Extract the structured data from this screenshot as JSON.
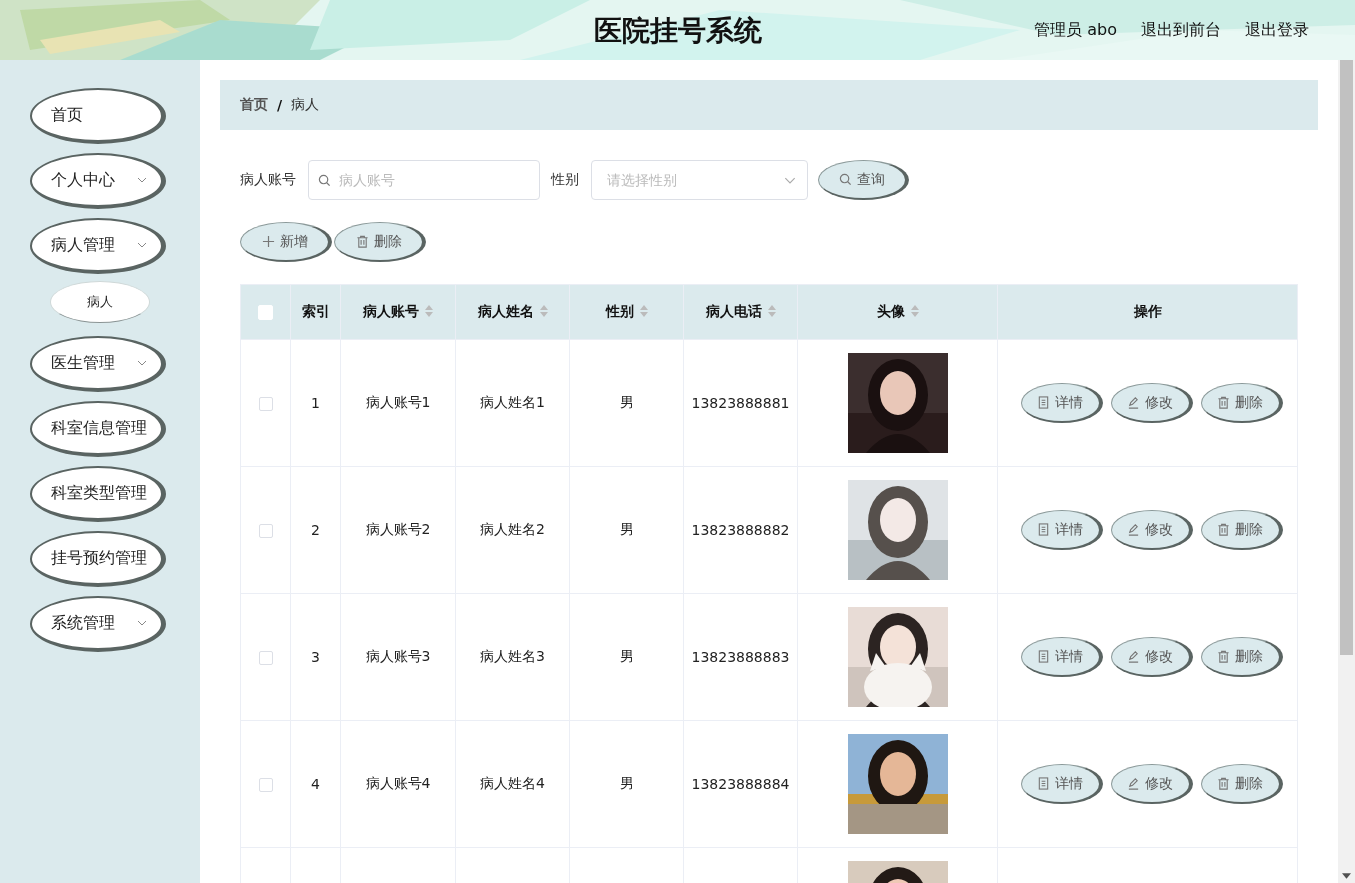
{
  "header": {
    "title": "医院挂号系统",
    "links": [
      "管理员 abo",
      "退出到前台",
      "退出登录"
    ]
  },
  "sidebar": {
    "items": [
      {
        "kind": "link",
        "label": "首页"
      },
      {
        "kind": "group",
        "label": "个人中心"
      },
      {
        "kind": "group",
        "label": "病人管理",
        "children": [
          {
            "label": "病人"
          }
        ]
      },
      {
        "kind": "group",
        "label": "医生管理"
      },
      {
        "kind": "link",
        "label": "科室信息管理"
      },
      {
        "kind": "link",
        "label": "科室类型管理"
      },
      {
        "kind": "link",
        "label": "挂号预约管理"
      },
      {
        "kind": "group",
        "label": "系统管理"
      }
    ]
  },
  "breadcrumb": {
    "items": [
      "首页",
      "病人"
    ],
    "separator": "/"
  },
  "search": {
    "fields": [
      {
        "kind": "text",
        "label": "病人账号",
        "placeholder": "病人账号"
      },
      {
        "kind": "select",
        "label": "性别",
        "placeholder": "请选择性别"
      }
    ],
    "button": "查询"
  },
  "actions": [
    {
      "kind": "add",
      "label": "新增"
    },
    {
      "kind": "delete",
      "label": "删除"
    }
  ],
  "table": {
    "header_checkbox": {
      "checked": false
    },
    "columns": [
      {
        "label": "索引",
        "sortable": false
      },
      {
        "label": "病人账号",
        "sortable": true
      },
      {
        "label": "病人姓名",
        "sortable": true
      },
      {
        "label": "性别",
        "sortable": true
      },
      {
        "label": "病人电话",
        "sortable": true
      },
      {
        "label": "头像",
        "sortable": true
      },
      {
        "label": "操作",
        "sortable": false
      }
    ],
    "rows": [
      {
        "checked": false,
        "cells": [
          "1",
          "病人账号1",
          "病人姓名1",
          "男",
          "13823888881"
        ],
        "avatar": {
          "kind": "picture"
        },
        "actions": [
          {
            "kind": "detail",
            "label": "详情"
          },
          {
            "kind": "edit",
            "label": "修改"
          },
          {
            "kind": "delete",
            "label": "删除"
          }
        ]
      },
      {
        "checked": false,
        "cells": [
          "2",
          "病人账号2",
          "病人姓名2",
          "男",
          "13823888882"
        ],
        "avatar": {
          "kind": "picture"
        },
        "actions": [
          {
            "kind": "detail",
            "label": "详情"
          },
          {
            "kind": "edit",
            "label": "修改"
          },
          {
            "kind": "delete",
            "label": "删除"
          }
        ]
      },
      {
        "checked": false,
        "cells": [
          "3",
          "病人账号3",
          "病人姓名3",
          "男",
          "13823888883"
        ],
        "avatar": {
          "kind": "picture"
        },
        "actions": [
          {
            "kind": "detail",
            "label": "详情"
          },
          {
            "kind": "edit",
            "label": "修改"
          },
          {
            "kind": "delete",
            "label": "删除"
          }
        ]
      },
      {
        "checked": false,
        "cells": [
          "4",
          "病人账号4",
          "病人姓名4",
          "男",
          "13823888884"
        ],
        "avatar": {
          "kind": "picture"
        },
        "actions": [
          {
            "kind": "detail",
            "label": "详情"
          },
          {
            "kind": "edit",
            "label": "修改"
          },
          {
            "kind": "delete",
            "label": "删除"
          }
        ]
      },
      {
        "avatar": {
          "kind": "picture"
        }
      }
    ]
  }
}
